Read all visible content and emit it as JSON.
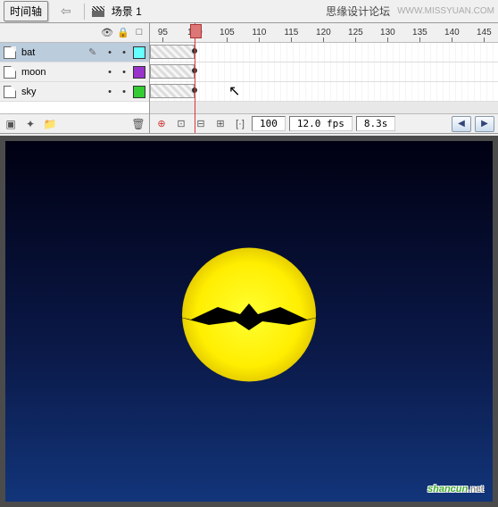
{
  "header": {
    "timeline_btn": "时间轴",
    "scene_label": "场景 1",
    "site_text": "思缘设计论坛",
    "site_url": "WWW.MISSYUAN.COM"
  },
  "layers": {
    "items": [
      {
        "name": "bat",
        "color": "#66ffff",
        "active": true,
        "editable": true
      },
      {
        "name": "moon",
        "color": "#9933cc",
        "active": false,
        "editable": false
      },
      {
        "name": "sky",
        "color": "#33cc33",
        "active": false,
        "editable": false
      }
    ]
  },
  "timeline": {
    "ruler": [
      "95",
      "100",
      "105",
      "110",
      "115",
      "120",
      "125",
      "130",
      "135",
      "140",
      "145"
    ],
    "playhead_frame": 100,
    "status": {
      "frame": "100",
      "fps": "12.0 fps",
      "time": "8.3s"
    }
  },
  "watermark": {
    "text": "shancun",
    "suffix": ".net"
  }
}
